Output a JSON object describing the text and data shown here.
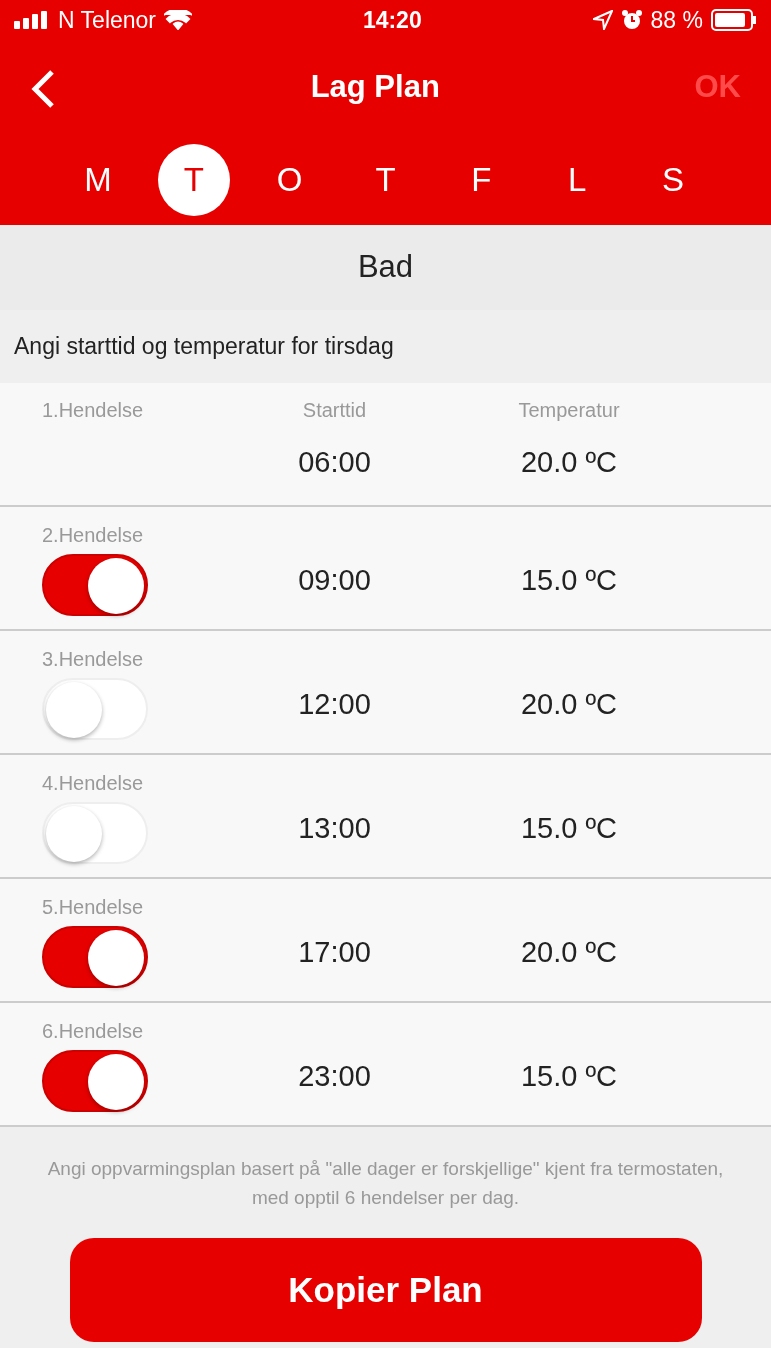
{
  "status_bar": {
    "carrier": "N Telenor",
    "time": "14:20",
    "battery_text": "88 %"
  },
  "nav": {
    "title": "Lag Plan",
    "ok": {
      "label": "OK",
      "disabled": true
    }
  },
  "days": [
    {
      "label": "M",
      "selected": false
    },
    {
      "label": "T",
      "selected": true
    },
    {
      "label": "O",
      "selected": false
    },
    {
      "label": "T",
      "selected": false
    },
    {
      "label": "F",
      "selected": false
    },
    {
      "label": "L",
      "selected": false
    },
    {
      "label": "S",
      "selected": false
    }
  ],
  "room": "Bad",
  "instruction": "Angi starttid og temperatur for tirsdag",
  "columns": {
    "start": "Starttid",
    "temp": "Temperatur"
  },
  "events": [
    {
      "kind": "fixed",
      "label": "1.Hendelse",
      "time": "06:00",
      "temp": "20.0 ºC"
    },
    {
      "kind": "toggle",
      "label": "2.Hendelse",
      "on": true,
      "time": "09:00",
      "temp": "15.0 ºC"
    },
    {
      "kind": "toggle",
      "label": "3.Hendelse",
      "on": false,
      "time": "12:00",
      "temp": "20.0 ºC"
    },
    {
      "kind": "toggle",
      "label": "4.Hendelse",
      "on": false,
      "time": "13:00",
      "temp": "15.0 ºC"
    },
    {
      "kind": "toggle",
      "label": "5.Hendelse",
      "on": true,
      "time": "17:00",
      "temp": "20.0 ºC"
    },
    {
      "kind": "toggle",
      "label": "6.Hendelse",
      "on": true,
      "time": "23:00",
      "temp": "15.0 ºC"
    }
  ],
  "note": "Angi oppvarmingsplan basert på \"alle dager er forskjellige\" kjent fra termostaten, med opptil 6 hendelser per dag.",
  "copy_button": "Kopier Plan"
}
